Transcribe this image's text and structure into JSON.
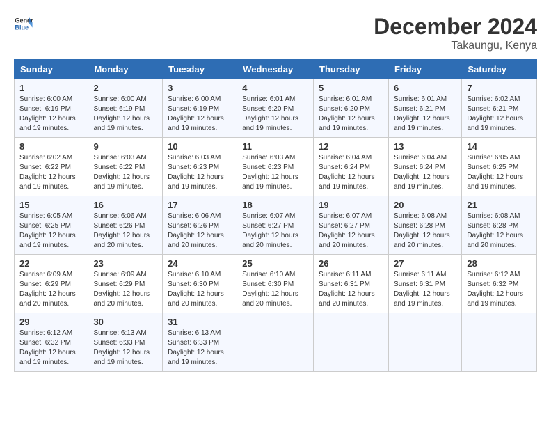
{
  "logo": {
    "line1": "General",
    "line2": "Blue"
  },
  "title": "December 2024",
  "subtitle": "Takaungu, Kenya",
  "days_of_week": [
    "Sunday",
    "Monday",
    "Tuesday",
    "Wednesday",
    "Thursday",
    "Friday",
    "Saturday"
  ],
  "weeks": [
    [
      {
        "day": "1",
        "sunrise": "Sunrise: 6:00 AM",
        "sunset": "Sunset: 6:19 PM",
        "daylight": "Daylight: 12 hours and 19 minutes."
      },
      {
        "day": "2",
        "sunrise": "Sunrise: 6:00 AM",
        "sunset": "Sunset: 6:19 PM",
        "daylight": "Daylight: 12 hours and 19 minutes."
      },
      {
        "day": "3",
        "sunrise": "Sunrise: 6:00 AM",
        "sunset": "Sunset: 6:19 PM",
        "daylight": "Daylight: 12 hours and 19 minutes."
      },
      {
        "day": "4",
        "sunrise": "Sunrise: 6:01 AM",
        "sunset": "Sunset: 6:20 PM",
        "daylight": "Daylight: 12 hours and 19 minutes."
      },
      {
        "day": "5",
        "sunrise": "Sunrise: 6:01 AM",
        "sunset": "Sunset: 6:20 PM",
        "daylight": "Daylight: 12 hours and 19 minutes."
      },
      {
        "day": "6",
        "sunrise": "Sunrise: 6:01 AM",
        "sunset": "Sunset: 6:21 PM",
        "daylight": "Daylight: 12 hours and 19 minutes."
      },
      {
        "day": "7",
        "sunrise": "Sunrise: 6:02 AM",
        "sunset": "Sunset: 6:21 PM",
        "daylight": "Daylight: 12 hours and 19 minutes."
      }
    ],
    [
      {
        "day": "8",
        "sunrise": "Sunrise: 6:02 AM",
        "sunset": "Sunset: 6:22 PM",
        "daylight": "Daylight: 12 hours and 19 minutes."
      },
      {
        "day": "9",
        "sunrise": "Sunrise: 6:03 AM",
        "sunset": "Sunset: 6:22 PM",
        "daylight": "Daylight: 12 hours and 19 minutes."
      },
      {
        "day": "10",
        "sunrise": "Sunrise: 6:03 AM",
        "sunset": "Sunset: 6:23 PM",
        "daylight": "Daylight: 12 hours and 19 minutes."
      },
      {
        "day": "11",
        "sunrise": "Sunrise: 6:03 AM",
        "sunset": "Sunset: 6:23 PM",
        "daylight": "Daylight: 12 hours and 19 minutes."
      },
      {
        "day": "12",
        "sunrise": "Sunrise: 6:04 AM",
        "sunset": "Sunset: 6:24 PM",
        "daylight": "Daylight: 12 hours and 19 minutes."
      },
      {
        "day": "13",
        "sunrise": "Sunrise: 6:04 AM",
        "sunset": "Sunset: 6:24 PM",
        "daylight": "Daylight: 12 hours and 19 minutes."
      },
      {
        "day": "14",
        "sunrise": "Sunrise: 6:05 AM",
        "sunset": "Sunset: 6:25 PM",
        "daylight": "Daylight: 12 hours and 19 minutes."
      }
    ],
    [
      {
        "day": "15",
        "sunrise": "Sunrise: 6:05 AM",
        "sunset": "Sunset: 6:25 PM",
        "daylight": "Daylight: 12 hours and 19 minutes."
      },
      {
        "day": "16",
        "sunrise": "Sunrise: 6:06 AM",
        "sunset": "Sunset: 6:26 PM",
        "daylight": "Daylight: 12 hours and 20 minutes."
      },
      {
        "day": "17",
        "sunrise": "Sunrise: 6:06 AM",
        "sunset": "Sunset: 6:26 PM",
        "daylight": "Daylight: 12 hours and 20 minutes."
      },
      {
        "day": "18",
        "sunrise": "Sunrise: 6:07 AM",
        "sunset": "Sunset: 6:27 PM",
        "daylight": "Daylight: 12 hours and 20 minutes."
      },
      {
        "day": "19",
        "sunrise": "Sunrise: 6:07 AM",
        "sunset": "Sunset: 6:27 PM",
        "daylight": "Daylight: 12 hours and 20 minutes."
      },
      {
        "day": "20",
        "sunrise": "Sunrise: 6:08 AM",
        "sunset": "Sunset: 6:28 PM",
        "daylight": "Daylight: 12 hours and 20 minutes."
      },
      {
        "day": "21",
        "sunrise": "Sunrise: 6:08 AM",
        "sunset": "Sunset: 6:28 PM",
        "daylight": "Daylight: 12 hours and 20 minutes."
      }
    ],
    [
      {
        "day": "22",
        "sunrise": "Sunrise: 6:09 AM",
        "sunset": "Sunset: 6:29 PM",
        "daylight": "Daylight: 12 hours and 20 minutes."
      },
      {
        "day": "23",
        "sunrise": "Sunrise: 6:09 AM",
        "sunset": "Sunset: 6:29 PM",
        "daylight": "Daylight: 12 hours and 20 minutes."
      },
      {
        "day": "24",
        "sunrise": "Sunrise: 6:10 AM",
        "sunset": "Sunset: 6:30 PM",
        "daylight": "Daylight: 12 hours and 20 minutes."
      },
      {
        "day": "25",
        "sunrise": "Sunrise: 6:10 AM",
        "sunset": "Sunset: 6:30 PM",
        "daylight": "Daylight: 12 hours and 20 minutes."
      },
      {
        "day": "26",
        "sunrise": "Sunrise: 6:11 AM",
        "sunset": "Sunset: 6:31 PM",
        "daylight": "Daylight: 12 hours and 20 minutes."
      },
      {
        "day": "27",
        "sunrise": "Sunrise: 6:11 AM",
        "sunset": "Sunset: 6:31 PM",
        "daylight": "Daylight: 12 hours and 19 minutes."
      },
      {
        "day": "28",
        "sunrise": "Sunrise: 6:12 AM",
        "sunset": "Sunset: 6:32 PM",
        "daylight": "Daylight: 12 hours and 19 minutes."
      }
    ],
    [
      {
        "day": "29",
        "sunrise": "Sunrise: 6:12 AM",
        "sunset": "Sunset: 6:32 PM",
        "daylight": "Daylight: 12 hours and 19 minutes."
      },
      {
        "day": "30",
        "sunrise": "Sunrise: 6:13 AM",
        "sunset": "Sunset: 6:33 PM",
        "daylight": "Daylight: 12 hours and 19 minutes."
      },
      {
        "day": "31",
        "sunrise": "Sunrise: 6:13 AM",
        "sunset": "Sunset: 6:33 PM",
        "daylight": "Daylight: 12 hours and 19 minutes."
      },
      null,
      null,
      null,
      null
    ]
  ]
}
